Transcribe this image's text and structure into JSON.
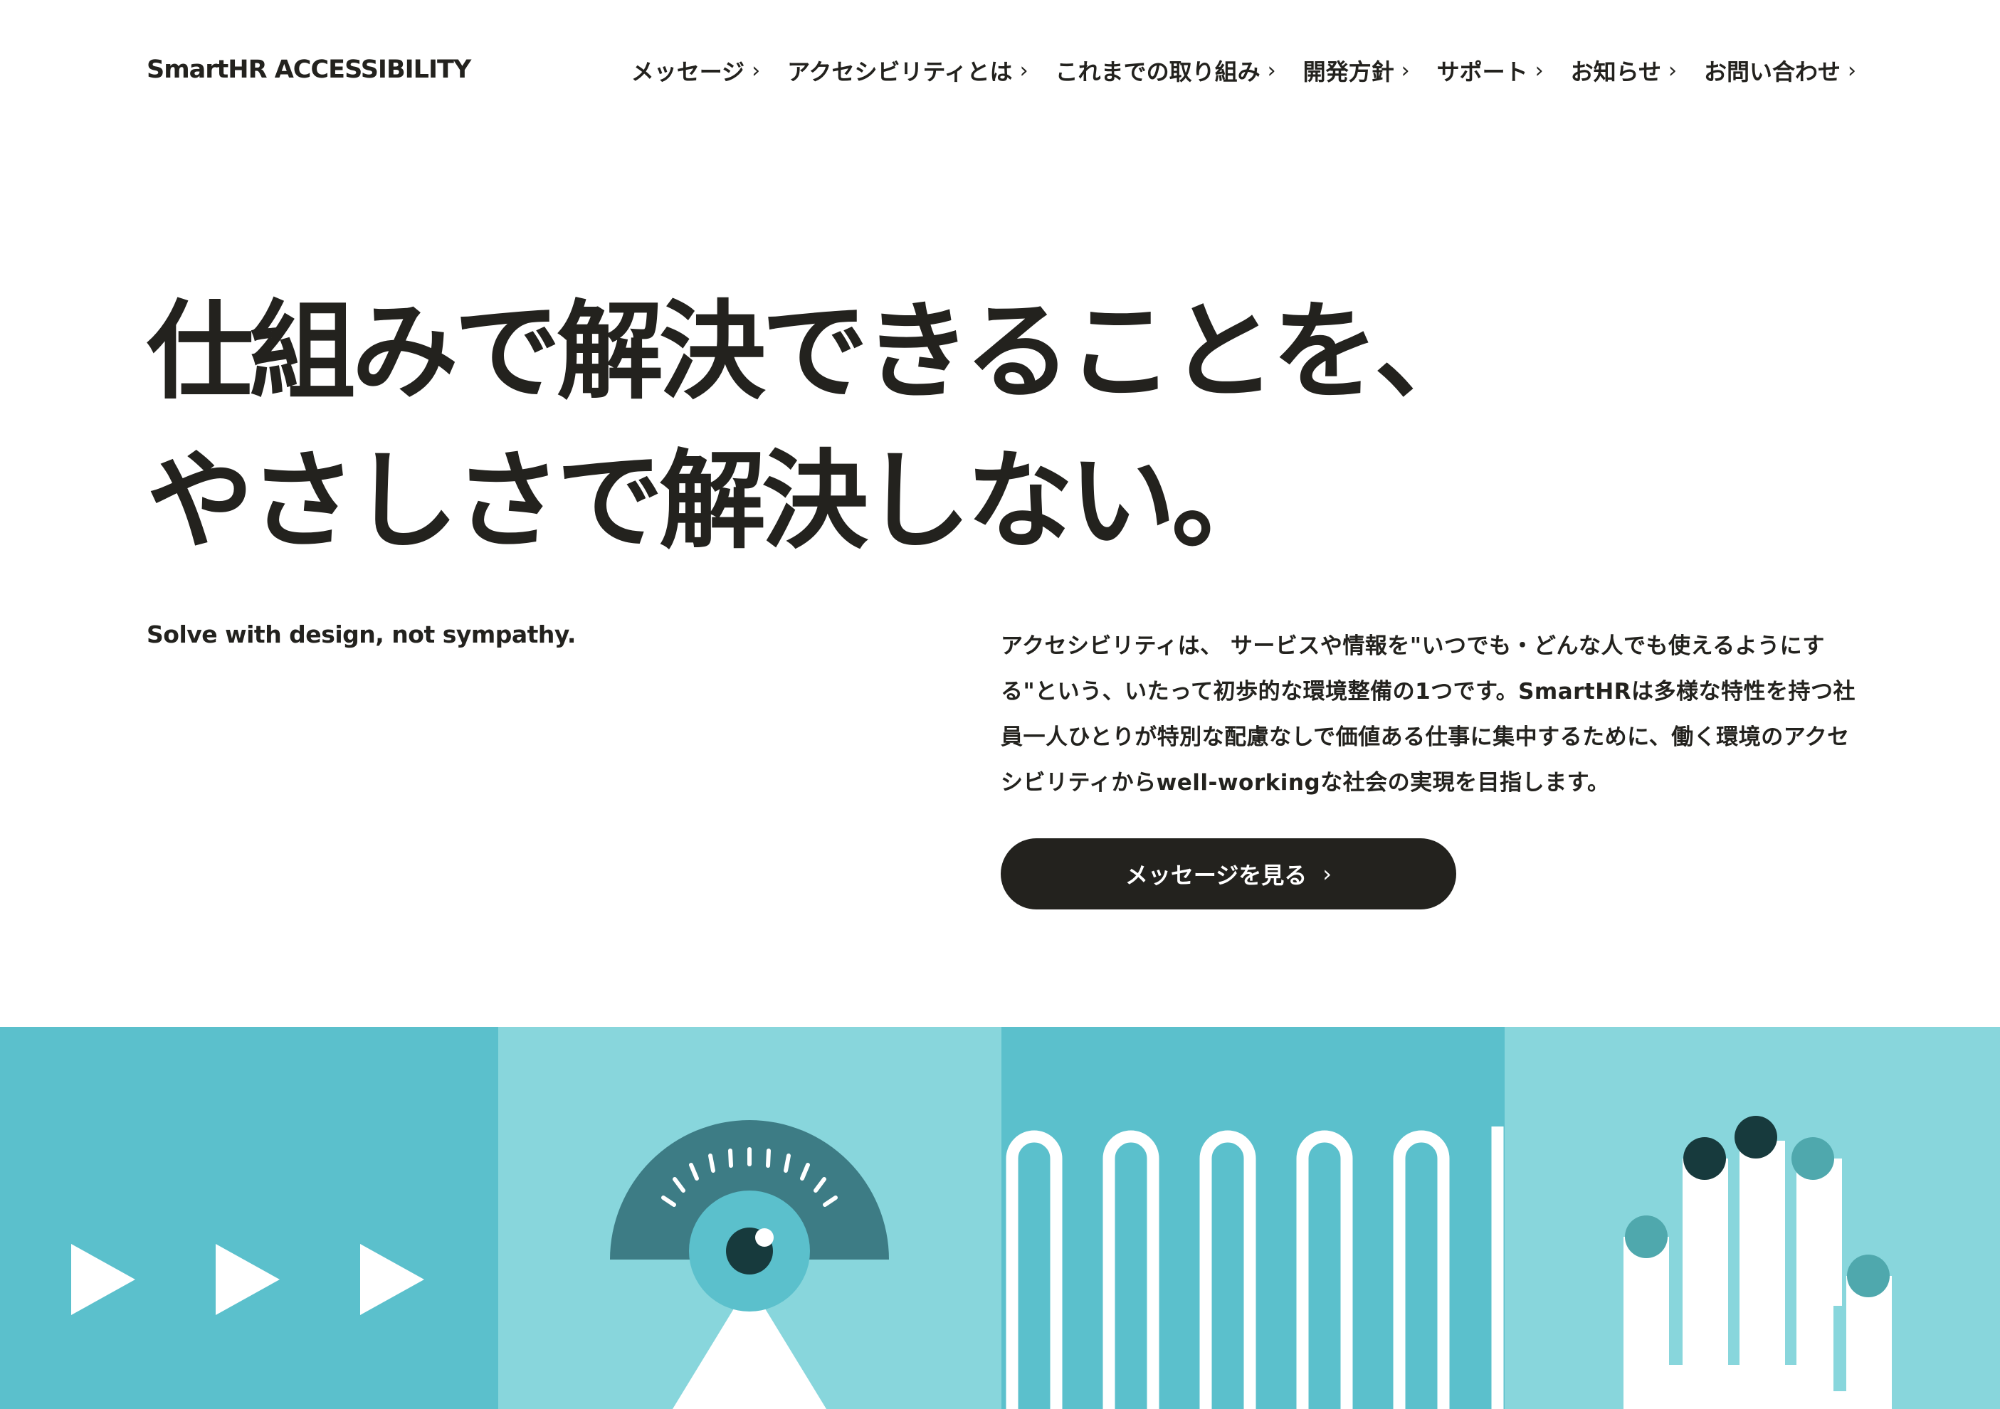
{
  "header": {
    "logo": "SmartHR ACCESSIBILITY",
    "nav": [
      {
        "label": "メッセージ"
      },
      {
        "label": "アクセシビリティとは"
      },
      {
        "label": "これまでの取り組み"
      },
      {
        "label": "開発方針"
      },
      {
        "label": "サポート"
      },
      {
        "label": "お知らせ"
      },
      {
        "label": "お問い合わせ"
      }
    ],
    "chevron": "›"
  },
  "hero": {
    "headline_line1": "仕組みで解決できることを、",
    "headline_line2": "やさしさで解決しない。",
    "subtitle": "Solve with design, not sympathy.",
    "intro": "アクセシビリティは、 サービスや情報を\"いつでも・どんな人でも使えるようにする\"という、いたって初歩的な環境整備の1つです。SmartHRは多様な特性を持つ社員一人ひとりが特別な配慮なしで価値ある仕事に集中するために、働く環境のアクセシビリティからwell-workingな社会の実現を目指します。",
    "cta_label": "メッセージを見る",
    "cta_icon": "chevron-right-icon"
  },
  "illustrations": {
    "panel_colors": [
      "#5bc0cc",
      "#88d6dc",
      "#5bc0cc",
      "#88d6dc"
    ],
    "dark_teal": "#3d7c85",
    "darkest": "#173a3d",
    "white": "#ffffff",
    "icons": [
      "play-triangles-icon",
      "eye-icon",
      "waveform-icon",
      "hand-icon"
    ]
  }
}
